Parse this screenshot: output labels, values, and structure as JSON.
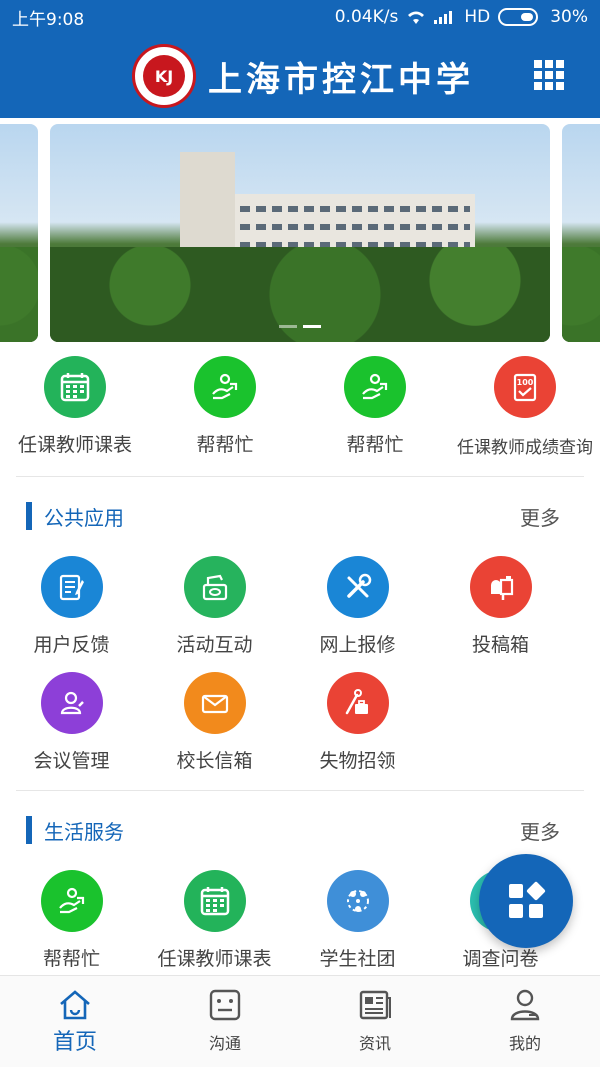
{
  "status_bar": {
    "time": "上午9:08",
    "network_speed": "0.04K/s",
    "network_type": "HD",
    "battery": "30%"
  },
  "header": {
    "title": "上海市控江中学",
    "logo_text": "KJ",
    "menu_icon": "grid-icon"
  },
  "carousel": {
    "slides": 3,
    "active_index": 1
  },
  "quick_apps": [
    {
      "label": "任课教师课表",
      "icon": "calendar-icon",
      "color": "#23b35a"
    },
    {
      "label": "帮帮忙",
      "icon": "helping-hand-icon",
      "color": "#1ac22d"
    },
    {
      "label": "帮帮忙",
      "icon": "helping-hand-icon",
      "color": "#1ac22d"
    },
    {
      "label": "任课教师成绩查询",
      "icon": "score-report-icon",
      "color": "#ea4335"
    }
  ],
  "sections": {
    "public": {
      "title": "公共应用",
      "more": "更多",
      "items": [
        {
          "label": "用户反馈",
          "icon": "feedback-icon",
          "color": "#1a86d6"
        },
        {
          "label": "活动互动",
          "icon": "interaction-icon",
          "color": "#26b35d"
        },
        {
          "label": "网上报修",
          "icon": "repair-tools-icon",
          "color": "#1a86d6"
        },
        {
          "label": "投稿箱",
          "icon": "mailbox-icon",
          "color": "#ea4335"
        },
        {
          "label": "会议管理",
          "icon": "meeting-icon",
          "color": "#8d3fd8"
        },
        {
          "label": "校长信箱",
          "icon": "envelope-icon",
          "color": "#f28a1c"
        },
        {
          "label": "失物招领",
          "icon": "lost-found-icon",
          "color": "#ea4335"
        }
      ]
    },
    "life": {
      "title": "生活服务",
      "more": "更多",
      "items": [
        {
          "label": "帮帮忙",
          "icon": "helping-hand-icon",
          "color": "#1ac22d"
        },
        {
          "label": "任课教师课表",
          "icon": "calendar-icon",
          "color": "#23b35a"
        },
        {
          "label": "学生社团",
          "icon": "community-icon",
          "color": "#3f8fd8"
        },
        {
          "label": "调查问卷",
          "icon": "survey-icon",
          "color": "#2bbfb0"
        }
      ]
    }
  },
  "bottom_nav": [
    {
      "label": "首页",
      "icon": "home-icon",
      "active": true
    },
    {
      "label": "沟通",
      "icon": "chat-icon",
      "active": false
    },
    {
      "label": "资讯",
      "icon": "news-icon",
      "active": false
    },
    {
      "label": "我的",
      "icon": "profile-icon",
      "active": false
    }
  ],
  "colors": {
    "primary": "#1466b8",
    "text": "#444444"
  }
}
